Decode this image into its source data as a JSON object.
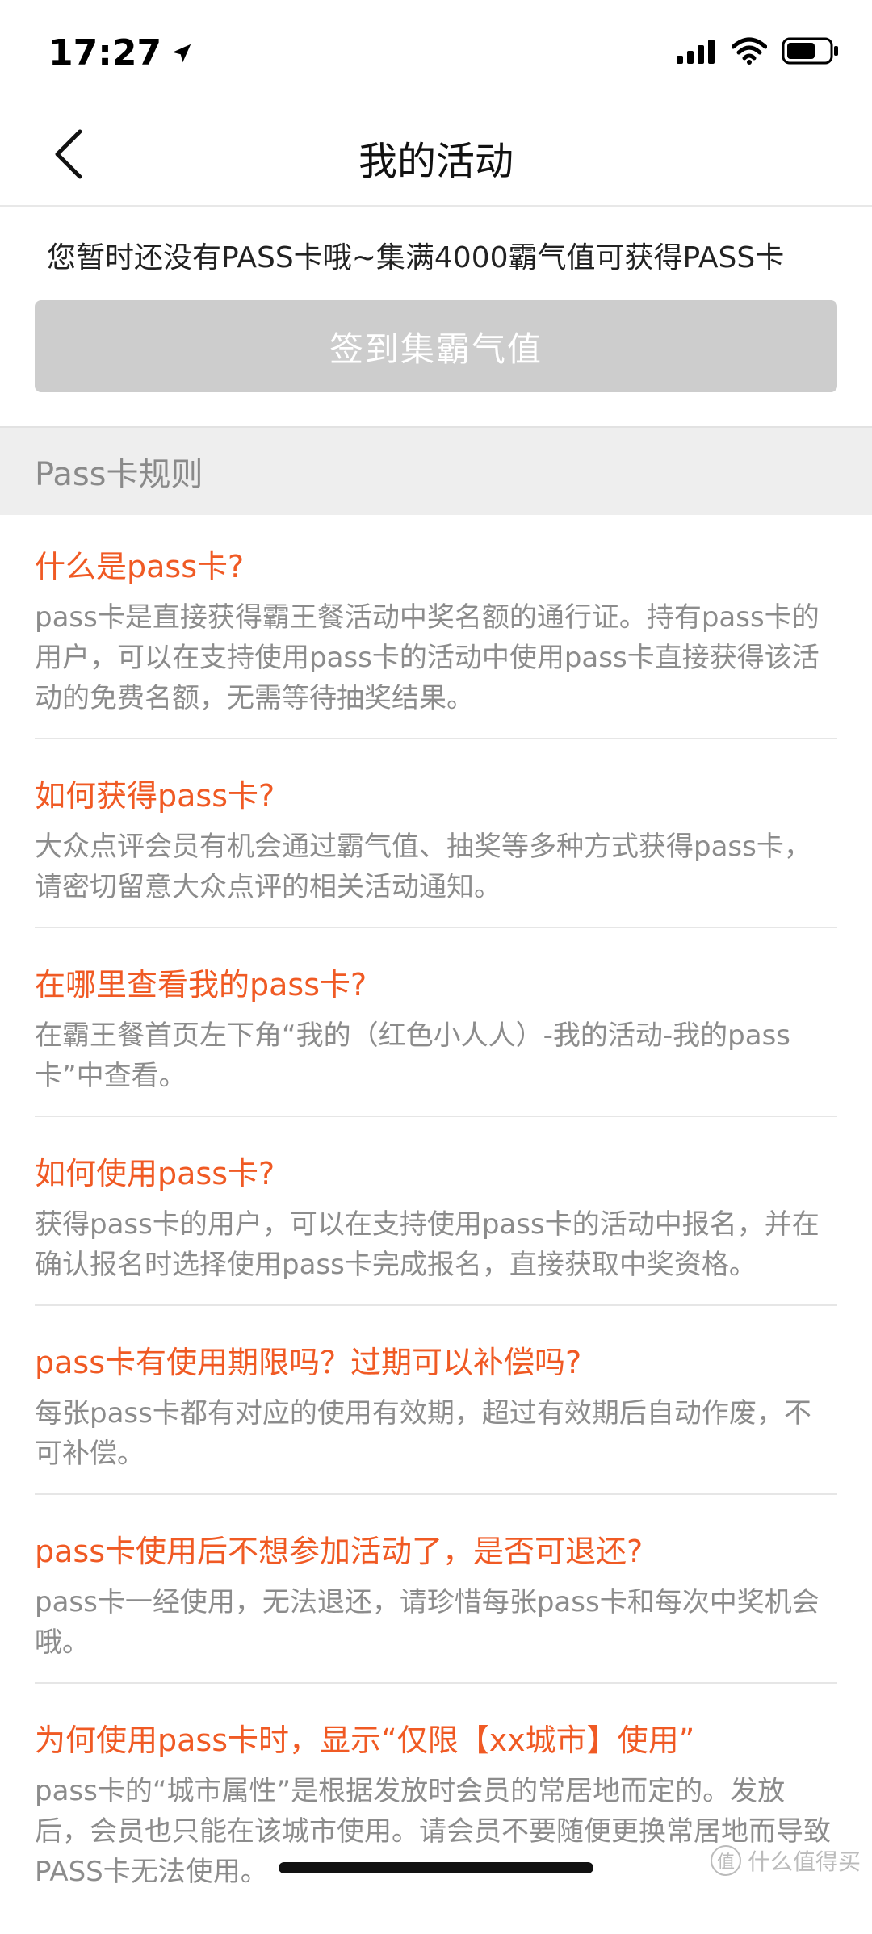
{
  "status_bar": {
    "time": "17:27",
    "icons": [
      "location-arrow-icon",
      "signal-icon",
      "wifi-icon",
      "battery-icon"
    ]
  },
  "header": {
    "title": "我的活动",
    "back_icon": "chevron-left-icon"
  },
  "notice": {
    "text": "您暂时还没有PASS卡哦~集满4000霸气值可获得PASS卡"
  },
  "checkin": {
    "label": "签到集霸气值"
  },
  "rules": {
    "title": "Pass卡规则",
    "items": [
      {
        "question": "什么是pass卡?",
        "answer": "pass卡是直接获得霸王餐活动中奖名额的通行证。持有pass卡的用户，可以在支持使用pass卡的活动中使用pass卡直接获得该活动的免费名额，无需等待抽奖结果。"
      },
      {
        "question": "如何获得pass卡?",
        "answer": "大众点评会员有机会通过霸气值、抽奖等多种方式获得pass卡，请密切留意大众点评的相关活动通知。"
      },
      {
        "question": "在哪里查看我的pass卡?",
        "answer": "在霸王餐首页左下角“我的（红色小人人）-我的活动-我的pass卡”中查看。"
      },
      {
        "question": "如何使用pass卡?",
        "answer": "获得pass卡的用户，可以在支持使用pass卡的活动中报名，并在确认报名时选择使用pass卡完成报名，直接获取中奖资格。"
      },
      {
        "question": "pass卡有使用期限吗？过期可以补偿吗?",
        "answer": "每张pass卡都有对应的使用有效期，超过有效期后自动作废，不可补偿。"
      },
      {
        "question": "pass卡使用后不想参加活动了，是否可退还?",
        "answer": "pass卡一经使用，无法退还，请珍惜每张pass卡和每次中奖机会哦。"
      },
      {
        "question": "为何使用pass卡时，显示“仅限【xx城市】使用”",
        "answer": "pass卡的“城市属性”是根据发放时会员的常居地而定的。发放后，会员也只能在该城市使用。请会员不要随便更换常居地而导致PASS卡无法使用。"
      }
    ]
  },
  "watermark": {
    "text": "什么值得买",
    "badge": "值"
  },
  "colors": {
    "accent": "#f05a24",
    "button_disabled": "#cdcdcd",
    "section_bg": "#eeeeee",
    "answer_text": "#8c8c8c"
  }
}
